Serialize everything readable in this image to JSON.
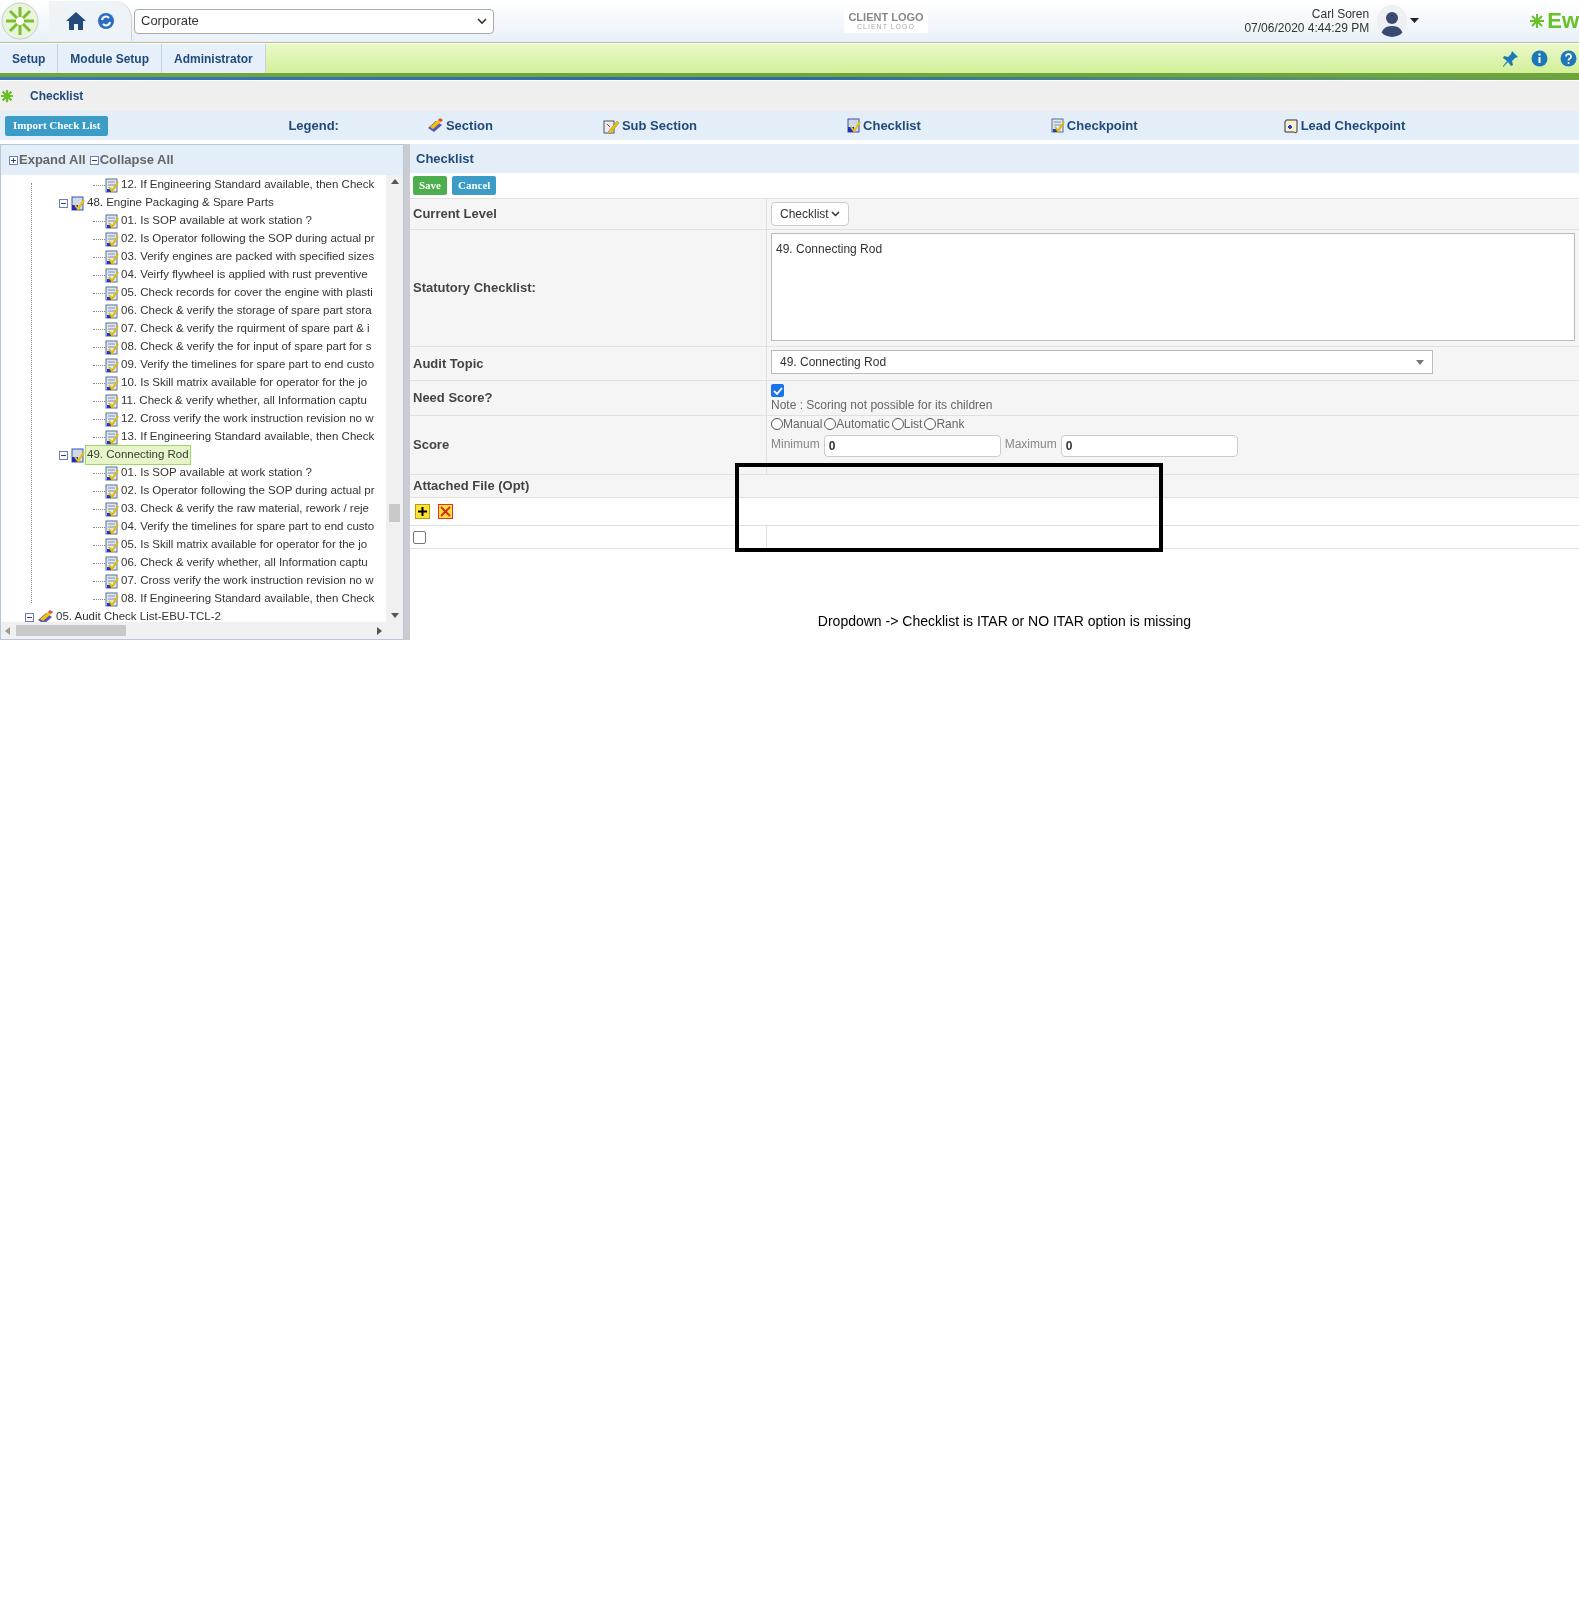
{
  "header": {
    "company_select": "Corporate",
    "client_logo": {
      "main": "CLIENT LOGO",
      "sub": "CLIENT LOGO"
    },
    "user_name": "Carl Soren",
    "datetime": "07/06/2020 4:44:29 PM",
    "brand": "Ew"
  },
  "nav_tabs": [
    {
      "label": "Setup"
    },
    {
      "label": "Module Setup"
    },
    {
      "label": "Administrator"
    }
  ],
  "breadcrumb": "Checklist",
  "import_button": "Import Check List",
  "legend": {
    "label": "Legend:",
    "items": [
      {
        "kind": "section",
        "label": "Section"
      },
      {
        "kind": "subsection",
        "label": "Sub Section"
      },
      {
        "kind": "checklist",
        "label": "Checklist"
      },
      {
        "kind": "checkpoint",
        "label": "Checkpoint"
      },
      {
        "kind": "lead",
        "label": "Lead Checkpoint"
      }
    ]
  },
  "tree": {
    "expand_all": "Expand All",
    "collapse_all": "Collapse All",
    "nodes": [
      {
        "children": [
          {
            "children": [
              {
                "kind": "checkpoint",
                "label": "12. If Engineering Standard available, then Check",
                "selected": false
              }
            ]
          },
          {
            "kind": "checklist",
            "label": "48. Engine Packaging & Spare Parts",
            "selected": false,
            "expanded": true,
            "children": [
              {
                "kind": "checkpoint",
                "label": "01. Is SOP available at work station ?",
                "selected": false
              },
              {
                "kind": "checkpoint",
                "label": "02. Is Operator following the SOP during actual pr",
                "selected": false
              },
              {
                "kind": "checkpoint",
                "label": "03. Verify engines are packed with specified sizes",
                "selected": false
              },
              {
                "kind": "checkpoint",
                "label": "04. Veirfy flywheel is applied with rust preventive",
                "selected": false
              },
              {
                "kind": "checkpoint",
                "label": "05. Check records for cover the engine with plasti",
                "selected": false
              },
              {
                "kind": "checkpoint",
                "label": "06. Check & verify the storage of spare part stora",
                "selected": false
              },
              {
                "kind": "checkpoint",
                "label": "07. Check & verify the rquirment of spare part & i",
                "selected": false
              },
              {
                "kind": "checkpoint",
                "label": "08. Check & verify the for input of spare part for s",
                "selected": false
              },
              {
                "kind": "checkpoint",
                "label": "09. Verify the timelines for spare part to end custo",
                "selected": false
              },
              {
                "kind": "checkpoint",
                "label": "10. Is Skill matrix available for operator for the jo",
                "selected": false
              },
              {
                "kind": "checkpoint",
                "label": "11. Check & verify whether, all Information captu",
                "selected": false
              },
              {
                "kind": "checkpoint",
                "label": "12. Cross verify the work instruction revision no w",
                "selected": false
              },
              {
                "kind": "checkpoint",
                "label": "13. If Engineering Standard available, then Check",
                "selected": false
              }
            ]
          },
          {
            "kind": "checklist",
            "label": "49. Connecting Rod",
            "selected": true,
            "expanded": true,
            "children": [
              {
                "kind": "checkpoint",
                "label": "01. Is SOP available at work station ?",
                "selected": false
              },
              {
                "kind": "checkpoint",
                "label": "02. Is Operator following the SOP during actual pr",
                "selected": false
              },
              {
                "kind": "checkpoint",
                "label": "03. Check & verify the raw material, rework / reje",
                "selected": false
              },
              {
                "kind": "checkpoint",
                "label": "04. Verify the timelines for spare part to end custo",
                "selected": false
              },
              {
                "kind": "checkpoint",
                "label": "05. Is Skill matrix available for operator for the jo",
                "selected": false
              },
              {
                "kind": "checkpoint",
                "label": "06. Check & verify whether, all Information captu",
                "selected": false
              },
              {
                "kind": "checkpoint",
                "label": "07. Cross verify the work instruction revision no w",
                "selected": false
              },
              {
                "kind": "checkpoint",
                "label": "08. If Engineering Standard available, then Check",
                "selected": false
              }
            ]
          }
        ]
      },
      {
        "kind": "section",
        "label": "05. Audit Check List-EBU-TCL-2",
        "selected": false,
        "expanded": true
      }
    ]
  },
  "form": {
    "title": "Checklist",
    "save": "Save",
    "cancel": "Cancel",
    "current_level": {
      "label": "Current Level",
      "value": "Checklist"
    },
    "statutory_checklist": {
      "label": "Statutory Checklist:",
      "value": "49. Connecting Rod"
    },
    "audit_topic": {
      "label": "Audit Topic",
      "value": "49. Connecting Rod"
    },
    "need_score": {
      "label": "Need Score?",
      "checked": true,
      "note": "Note : Scoring not possible for its children"
    },
    "score": {
      "label": "Score",
      "types": [
        {
          "label": "Manual",
          "selected": false
        },
        {
          "label": "Automatic",
          "selected": false
        },
        {
          "label": "List",
          "selected": false
        },
        {
          "label": "Rank",
          "selected": false
        }
      ],
      "minimum_label": "Minimum",
      "minimum": "0",
      "maximum_label": "Maximum",
      "maximum": "0"
    },
    "attached_file": {
      "label": "Attached File (Opt)",
      "file_checked": false
    }
  },
  "annotation_note": "Dropdown -> Checklist is ITAR or NO ITAR option is missing"
}
